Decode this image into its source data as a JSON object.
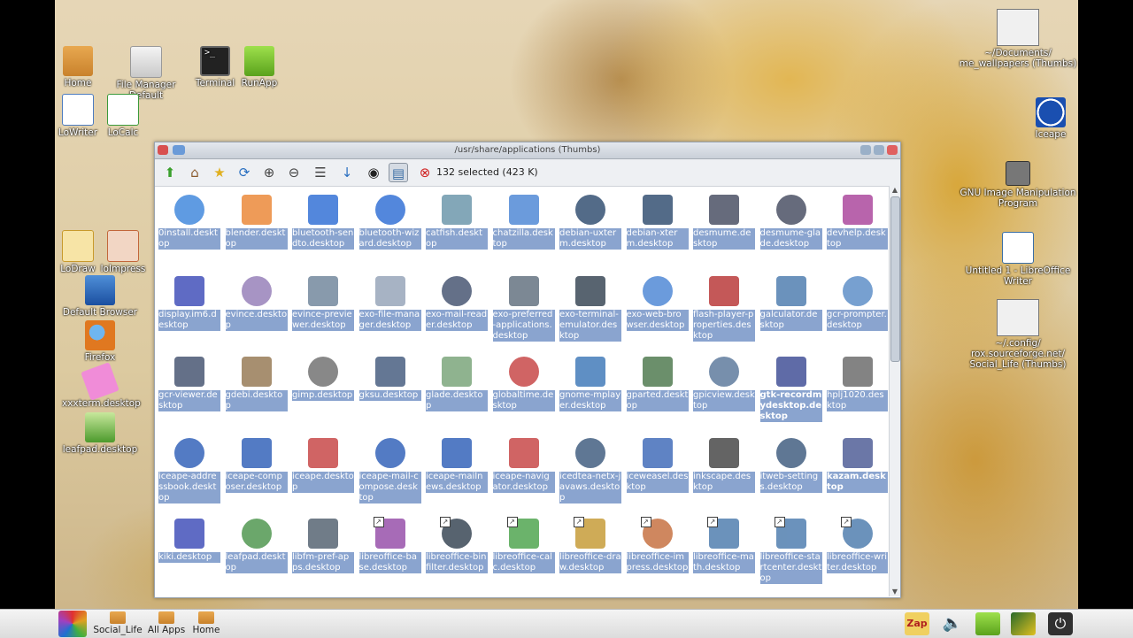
{
  "desktop": {
    "left_icons": [
      {
        "label": "Home"
      },
      {
        "label": "File Manager Default"
      },
      {
        "label": "Terminal"
      },
      {
        "label": "RunApp"
      },
      {
        "label": "LoWriter"
      },
      {
        "label": "LoCalc"
      },
      {
        "label": "LoDraw"
      },
      {
        "label": "loImpress"
      },
      {
        "label": "Default Browser"
      },
      {
        "label": "Firefox"
      },
      {
        "label": "xxxterm.desktop"
      },
      {
        "label": "leafpad.desktop"
      }
    ],
    "right_icons": [
      {
        "label": "~/Documents/ me_wallpapers (Thumbs)"
      },
      {
        "label": "Iceape"
      },
      {
        "label": "GNU Image Manipulation Program"
      },
      {
        "label": "Untitled 1 - LibreOffice Writer"
      },
      {
        "label": "~/.config/ rox.sourceforge.net/ Social_Life (Thumbs)"
      }
    ]
  },
  "window": {
    "title": "/usr/share/applications (Thumbs)",
    "status": "132 selected (423 K)",
    "toolbar": [
      {
        "name": "up-arrow-icon",
        "glyph": "⬆",
        "color": "#3aa02c"
      },
      {
        "name": "home-icon",
        "glyph": "⌂",
        "color": "#8a5a2c"
      },
      {
        "name": "bookmarks-icon",
        "glyph": "★",
        "color": "#e0b020"
      },
      {
        "name": "refresh-icon",
        "glyph": "⟳",
        "color": "#2a6fc0"
      },
      {
        "name": "zoom-in-icon",
        "glyph": "⊕",
        "color": "#444444"
      },
      {
        "name": "zoom-out-icon",
        "glyph": "⊖",
        "color": "#444444"
      },
      {
        "name": "details-view-icon",
        "glyph": "☰",
        "color": "#444444"
      },
      {
        "name": "sort-icon",
        "glyph": "↓",
        "color": "#2a6fc0"
      },
      {
        "name": "show-hidden-eye-icon",
        "glyph": "◉",
        "color": "#222222"
      },
      {
        "name": "select-all-icon",
        "glyph": "▤",
        "color": "#3a6ea5"
      },
      {
        "name": "help-lifebuoy-icon",
        "glyph": "⊗",
        "color": "#d02020"
      }
    ],
    "files": [
      {
        "label": "0install.desktop",
        "color": "#2a7ad8"
      },
      {
        "label": "blender.desktop",
        "color": "#e87a20"
      },
      {
        "label": "bluetooth-sendto.desktop",
        "color": "#1a5fd0"
      },
      {
        "label": "bluetooth-wizard.desktop",
        "color": "#1a5fd0"
      },
      {
        "label": "catfish.desktop",
        "color": "#5a8aa0"
      },
      {
        "label": "chatzilla.desktop",
        "color": "#3a7ad0"
      },
      {
        "label": "debian-uxterm.desktop",
        "color": "#1a3a60"
      },
      {
        "label": "debian-xterm.desktop",
        "color": "#1a3a60"
      },
      {
        "label": "desmume.desktop",
        "color": "#333a50"
      },
      {
        "label": "desmume-glade.desktop",
        "color": "#333a50"
      },
      {
        "label": "devhelp.desktop",
        "color": "#a03090"
      },
      {
        "label": "display.im6.desktop",
        "color": "#2a3ab0"
      },
      {
        "label": "evince.desktop",
        "color": "#8a70b0"
      },
      {
        "label": "evince-previewer.desktop",
        "color": "#607890"
      },
      {
        "label": "exo-file-manager.desktop",
        "color": "#8a9ab0"
      },
      {
        "label": "exo-mail-reader.desktop",
        "color": "#304060"
      },
      {
        "label": "exo-preferred-applications.desktop",
        "color": "#506070"
      },
      {
        "label": "exo-terminal-emulator.desktop",
        "color": "#203040"
      },
      {
        "label": "exo-web-browser.desktop",
        "color": "#3a7ad0"
      },
      {
        "label": "flash-player-properties.desktop",
        "color": "#b02020"
      },
      {
        "label": "galculator.desktop",
        "color": "#3a6ea5"
      },
      {
        "label": "gcr-prompter.desktop",
        "color": "#4a80c0"
      },
      {
        "label": "gcr-viewer.desktop",
        "color": "#304060"
      },
      {
        "label": "gdebi.desktop",
        "color": "#8a6a40"
      },
      {
        "label": "gimp.desktop",
        "color": "#606060"
      },
      {
        "label": "gksu.desktop",
        "color": "#304a70"
      },
      {
        "label": "glade.desktop",
        "color": "#6a9a6a"
      },
      {
        "label": "globaltime.desktop",
        "color": "#c03030"
      },
      {
        "label": "gnome-mplayer.desktop",
        "color": "#2a6ab0"
      },
      {
        "label": "gparted.desktop",
        "color": "#3a6a3a"
      },
      {
        "label": "gpicview.desktop",
        "color": "#4a6a90"
      },
      {
        "label": "gtk-recordmydesktop.desktop",
        "color": "#2a3a8a",
        "bold": true
      },
      {
        "label": "hplj1020.desktop",
        "color": "#5a5a5a"
      },
      {
        "label": "iceape-addressbook.desktop",
        "color": "#1a4fb0"
      },
      {
        "label": "iceape-composer.desktop",
        "color": "#1a4fb0"
      },
      {
        "label": "iceape.desktop",
        "color": "#c03030"
      },
      {
        "label": "iceape-mail-compose.desktop",
        "color": "#1a4fb0"
      },
      {
        "label": "iceape-mailnews.desktop",
        "color": "#1a4fb0"
      },
      {
        "label": "iceape-navigator.desktop",
        "color": "#c03030"
      },
      {
        "label": "icedtea-netx-javaws.desktop",
        "color": "#2a4a70"
      },
      {
        "label": "iceweasel.desktop",
        "color": "#2a5ab0"
      },
      {
        "label": "inkscape.desktop",
        "color": "#303030"
      },
      {
        "label": "itweb-settings.desktop",
        "color": "#2a4a70"
      },
      {
        "label": "kazam.desktop",
        "color": "#3a4a8a",
        "bold": true
      },
      {
        "label": "kiki.desktop",
        "color": "#2a3ab0"
      },
      {
        "label": "leafpad.desktop",
        "color": "#3a8a3a"
      },
      {
        "label": "libfm-pref-apps.desktop",
        "color": "#405060"
      },
      {
        "label": "libreoffice-base.desktop",
        "color": "#8a3aa0",
        "shortcut": true
      },
      {
        "label": "libreoffice-binfilter.desktop",
        "color": "#203040",
        "shortcut": true
      },
      {
        "label": "libreoffice-calc.desktop",
        "color": "#3a9a3a",
        "shortcut": true
      },
      {
        "label": "libreoffice-draw.desktop",
        "color": "#c09020",
        "shortcut": true
      },
      {
        "label": "libreoffice-impress.desktop",
        "color": "#c0602a",
        "shortcut": true
      },
      {
        "label": "libreoffice-math.desktop",
        "color": "#3a6ea5",
        "shortcut": true
      },
      {
        "label": "libreoffice-startcenter.desktop",
        "color": "#3a6ea5",
        "shortcut": true
      },
      {
        "label": "libreoffice-writer.desktop",
        "color": "#3a6ea5",
        "shortcut": true
      }
    ]
  },
  "taskbar": {
    "items": [
      {
        "label": "Social_Life"
      },
      {
        "label": "All Apps"
      },
      {
        "label": "Home"
      }
    ],
    "tray_zap": "Zap"
  },
  "colors": {
    "selection": "#8aa4cf",
    "window_border": "#9aa4b0"
  }
}
